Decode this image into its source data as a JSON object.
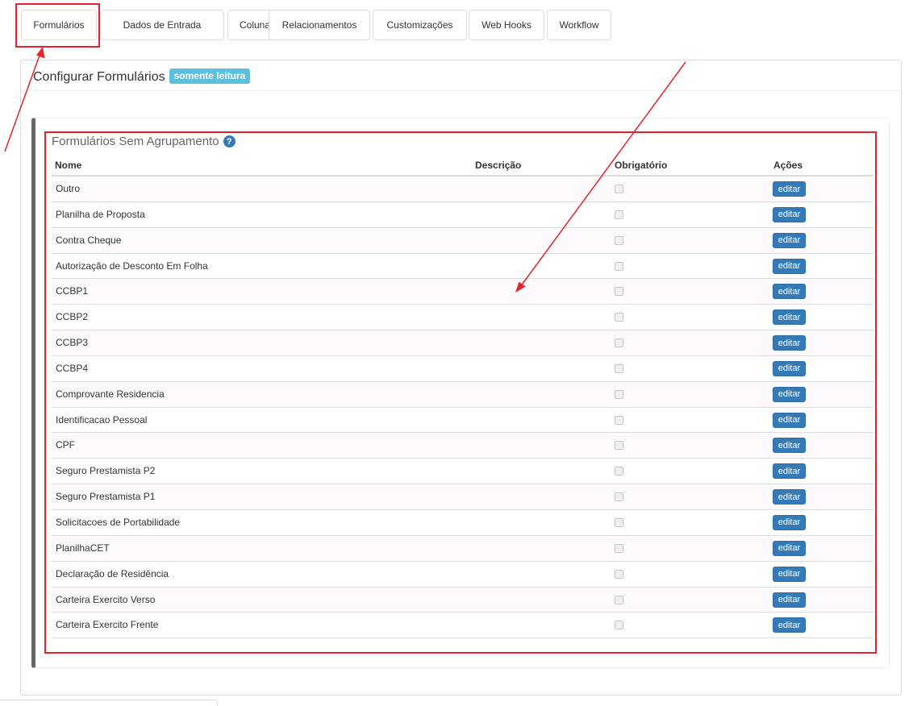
{
  "tabs": [
    {
      "label": "Formulários",
      "active": true
    },
    {
      "label": "Dados de Entrada",
      "active": false
    },
    {
      "label": "Colunas",
      "active": false
    },
    {
      "label": "Relacionamentos",
      "active": false
    },
    {
      "label": "Customizações",
      "active": false
    },
    {
      "label": "Web Hooks",
      "active": false
    },
    {
      "label": "Workflow",
      "active": false
    }
  ],
  "panel": {
    "title": "Configurar Formulários",
    "badge": "somente leitura"
  },
  "section": {
    "title": "Formulários Sem Agrupamento",
    "help_icon": "question-circle-icon"
  },
  "table": {
    "headers": {
      "name": "Nome",
      "description": "Descrição",
      "required": "Obrigatório",
      "actions": "Ações"
    },
    "edit_label": "editar",
    "rows": [
      {
        "name": "Outro",
        "description": "",
        "required": false
      },
      {
        "name": "Planilha de Proposta",
        "description": "",
        "required": false
      },
      {
        "name": "Contra Cheque",
        "description": "",
        "required": false
      },
      {
        "name": "Autorização de Desconto Em Folha",
        "description": "",
        "required": false
      },
      {
        "name": "CCBP1",
        "description": "",
        "required": false
      },
      {
        "name": "CCBP2",
        "description": "",
        "required": false
      },
      {
        "name": "CCBP3",
        "description": "",
        "required": false
      },
      {
        "name": "CCBP4",
        "description": "",
        "required": false
      },
      {
        "name": "Comprovante Residencia",
        "description": "",
        "required": false
      },
      {
        "name": "Identificacao Pessoal",
        "description": "",
        "required": false
      },
      {
        "name": "CPF",
        "description": "",
        "required": false
      },
      {
        "name": "Seguro Prestamista P2",
        "description": "",
        "required": false
      },
      {
        "name": "Seguro Prestamista P1",
        "description": "",
        "required": false
      },
      {
        "name": "Solicitacoes de Portabilidade",
        "description": "",
        "required": false
      },
      {
        "name": "PlanilhaCET",
        "description": "",
        "required": false
      },
      {
        "name": "Declaração de Residência",
        "description": "",
        "required": false
      },
      {
        "name": "Carteira Exercito Verso",
        "description": "",
        "required": false
      },
      {
        "name": "Carteira Exercito Frente",
        "description": "",
        "required": false
      }
    ]
  },
  "colors": {
    "primary": "#337ab7",
    "badge": "#5bc0de",
    "annotation": "#e3242b"
  }
}
